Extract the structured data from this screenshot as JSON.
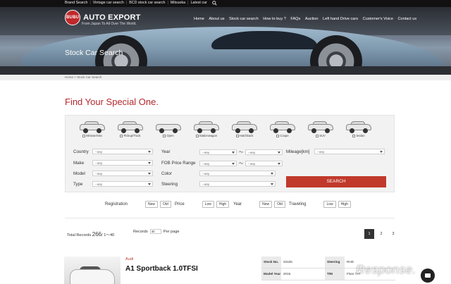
{
  "topnav": [
    "Brand Search",
    "Vintage car search",
    "BCD stock car search",
    "Mitsuoka",
    "Latest car"
  ],
  "logo": {
    "badge_text": "BUBU",
    "name": "AUTO EXPORT",
    "tagline": "From Japan To All Over The World."
  },
  "mainnav": [
    "Home",
    "About us",
    "Stock car search",
    "How to buy ?",
    "FAQs",
    "Auction",
    "Left hand Drive cars",
    "Customer's Voice",
    "Contact us"
  ],
  "hero_title": "Stock Car Search",
  "breadcrumb": "Home > Stock Car Search",
  "section_title": "Find Your Special One.",
  "body_types": [
    "Minivan/Van",
    "Pickup/Truck",
    "Open",
    "Stationwagon",
    "Hatchback",
    "Coupe",
    "SUV",
    "Sedan"
  ],
  "filters": {
    "country": "Country",
    "make": "Make",
    "model": "Model",
    "type": "Type",
    "year": "Year",
    "fob": "FOB Price Range",
    "color": "Color",
    "steering": "Steering",
    "mileage": "Mileage[km]",
    "any": "--any",
    "tilde": "〜"
  },
  "search_button": "SEARCH",
  "sort": {
    "registration": "Registration",
    "price": "Price",
    "year": "Year",
    "traveling": "Traveling",
    "new": "New",
    "old": "Old",
    "low": "Low",
    "high": "High"
  },
  "total": {
    "label": "Total Records",
    "count": "266",
    "range": "/ 1〜40"
  },
  "records": {
    "label": "Records",
    "value": "40",
    "suffix": "Per page"
  },
  "pages": [
    "1",
    "2",
    "3"
  ],
  "listing": {
    "maker": "Audi",
    "model": "A1 Sportback 1.0TFSI",
    "specs": [
      {
        "k1": "Stock No.",
        "v1": "33105",
        "k2": "Steering",
        "v2": "RHD"
      },
      {
        "k1": "Model Year",
        "v1": "2016",
        "k2": "T/M",
        "v2": "Floor 7AT"
      }
    ]
  },
  "watermark": "Response.",
  "colors": {
    "accent": "#c0392b",
    "topbar": "#111111"
  }
}
